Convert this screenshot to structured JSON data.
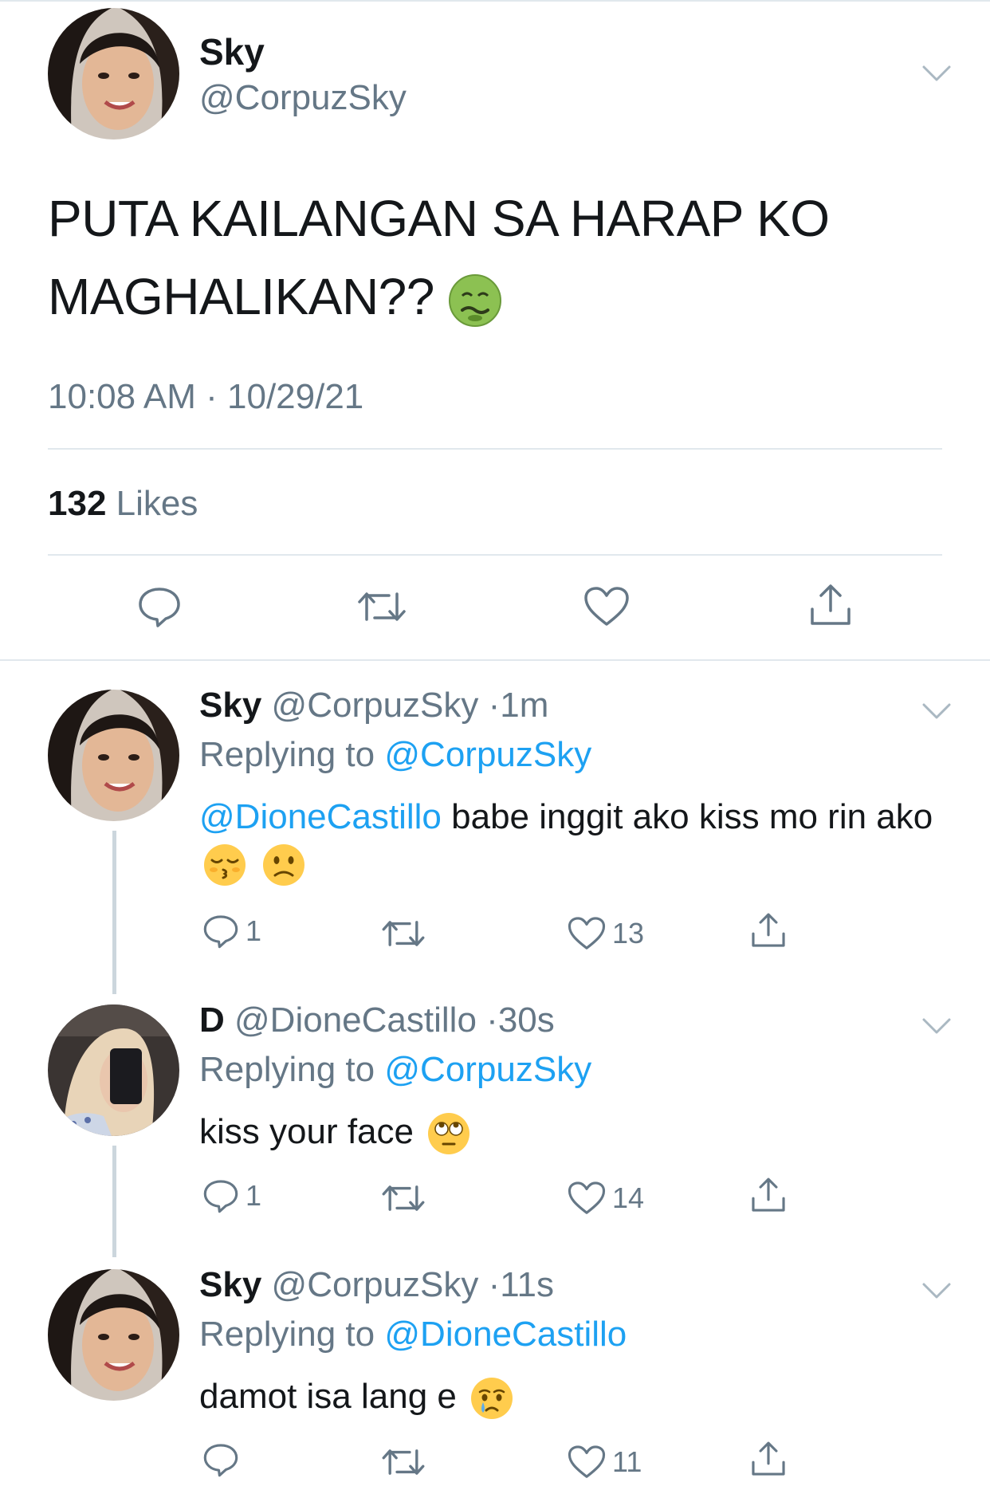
{
  "main_tweet": {
    "display_name": "Sky",
    "handle": "@CorpuzSky",
    "text": "PUTA KAILANGAN SA HARAP KO MAGHALIKAN??",
    "emoji": "nauseated-face",
    "timestamp": "10:08 AM · 10/29/21",
    "likes_count": "132",
    "likes_label": "Likes"
  },
  "replies": [
    {
      "display_name": "Sky",
      "handle": "@CorpuzSky",
      "separator": "·",
      "time": "1m",
      "replying_prefix": "Replying to",
      "replying_to": "@CorpuzSky",
      "text_mention": "@DioneCastillo",
      "text": "babe inggit ako kiss mo rin ako",
      "emojis": [
        "kissing-face-with-closed-eyes",
        "slightly-frowning-face"
      ],
      "reply_count": "1",
      "like_count": "13"
    },
    {
      "display_name": "D",
      "handle": "@DioneCastillo",
      "separator": "·",
      "time": "30s",
      "replying_prefix": "Replying to",
      "replying_to": "@CorpuzSky",
      "text": "kiss your face",
      "emojis": [
        "face-with-rolling-eyes"
      ],
      "reply_count": "1",
      "like_count": "14"
    },
    {
      "display_name": "Sky",
      "handle": "@CorpuzSky",
      "separator": "·",
      "time": "11s",
      "replying_prefix": "Replying to",
      "replying_to": "@DioneCastillo",
      "text": "damot isa lang e",
      "emojis": [
        "face-holding-back-tears"
      ],
      "reply_count": "",
      "like_count": "11"
    }
  ],
  "colors": {
    "text": "#14171a",
    "secondary": "#657786",
    "link": "#1da1f2",
    "divider": "#e1e8ed",
    "thread_line": "#ccd6dd"
  },
  "icons": [
    "reply-icon",
    "retweet-icon",
    "like-icon",
    "share-icon",
    "chevron-down-icon"
  ]
}
